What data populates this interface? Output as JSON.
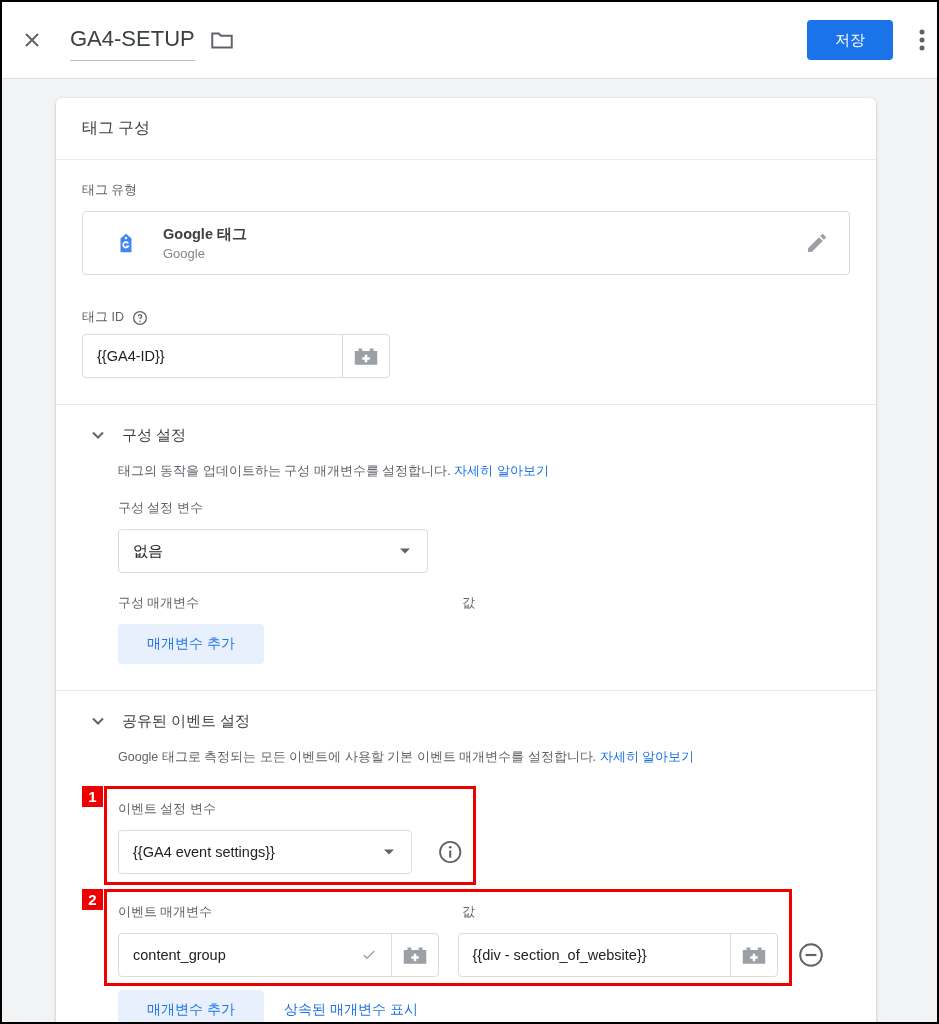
{
  "header": {
    "title": "GA4-SETUP",
    "save_button": "저장"
  },
  "card": {
    "title": "태그 구성",
    "tag_type": {
      "label": "태그 유형",
      "name": "Google 태그",
      "vendor": "Google"
    },
    "tag_id": {
      "label": "태그 ID",
      "value": "{{GA4-ID}}"
    },
    "sections": [
      {
        "title": "구성 설정",
        "expanded": true,
        "description": "태그의 동작을 업데이트하는 구성 매개변수를 설정합니다.",
        "link": "자세히 알아보기",
        "variable": {
          "label": "구성 설정 변수",
          "value": "없음"
        },
        "params": {
          "name_label": "구성 매개변수",
          "value_label": "값",
          "buttons": [
            "매개변수 추가"
          ]
        }
      },
      {
        "title": "공유된 이벤트 설정",
        "expanded": true,
        "description": "Google 태그로 측정되는 모든 이벤트에 사용할 기본 이벤트 매개변수를 설정합니다.",
        "link": "자세히 알아보기",
        "variable": {
          "label": "이벤트 설정 변수",
          "value": "{{GA4 event settings}}",
          "annotation": "1",
          "info": true
        },
        "params": {
          "name_label": "이벤트 매개변수",
          "value_label": "값",
          "annotation": "2",
          "rows": [
            {
              "name": "content_group",
              "value": "{{div - section_of_website}}",
              "valid": true
            }
          ],
          "buttons": [
            "매개변수 추가",
            "상속된 매개변수 표시"
          ]
        }
      }
    ]
  }
}
